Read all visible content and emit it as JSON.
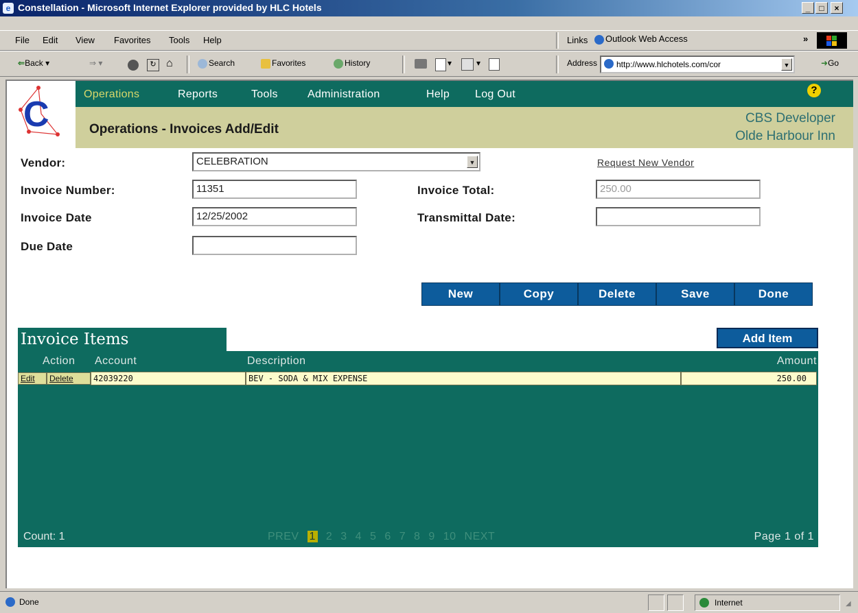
{
  "window": {
    "title": "Constellation - Microsoft Internet Explorer provided by HLC Hotels",
    "buttons": {
      "minimize": "_",
      "maximize": "□",
      "close": "×"
    }
  },
  "menu": {
    "items": [
      "File",
      "Edit",
      "View",
      "Favorites",
      "Tools",
      "Help"
    ],
    "links_label": "Links",
    "links_item": "Outlook Web Access",
    "chevron": "»"
  },
  "toolbar": {
    "back": "Back",
    "search": "Search",
    "favorites": "Favorites",
    "history": "History",
    "address_label": "Address",
    "address_value": "http://www.hlchotels.com/cor",
    "go": "Go"
  },
  "app": {
    "nav": [
      "Operations",
      "Reports",
      "Tools",
      "Administration",
      "Help",
      "Log Out"
    ],
    "help_icon": "?",
    "page_title": "Operations - Invoices Add/Edit",
    "user_name": "CBS Developer",
    "hotel_name": "Olde Harbour Inn"
  },
  "form": {
    "vendor_label": "Vendor:",
    "vendor_value": "CELEBRATION",
    "request_vendor": "Request New Vendor",
    "invoice_number_label": "Invoice Number:",
    "invoice_number_value": "11351",
    "invoice_total_label": "Invoice Total:",
    "invoice_total_value": "250.00",
    "invoice_date_label": "Invoice Date",
    "invoice_date_value": "12/25/2002",
    "transmittal_date_label": "Transmittal Date:",
    "transmittal_date_value": "",
    "due_date_label": "Due Date",
    "due_date_value": ""
  },
  "actions": {
    "new": "New",
    "copy": "Copy",
    "delete": "Delete",
    "save": "Save",
    "done": "Done"
  },
  "items": {
    "tab_title": "Invoice Items",
    "add_item": "Add Item",
    "columns": {
      "action": "Action",
      "account": "Account",
      "description": "Description",
      "amount": "Amount"
    },
    "rows": [
      {
        "edit": "Edit",
        "delete": "Delete",
        "account": "42039220",
        "description": "BEV - SODA & MIX EXPENSE",
        "amount": "250.00"
      }
    ],
    "count": "Count: 1",
    "pager": {
      "prev": "PREV",
      "pages": [
        "1",
        "2",
        "3",
        "4",
        "5",
        "6",
        "7",
        "8",
        "9",
        "10"
      ],
      "next": "NEXT",
      "current": "1"
    },
    "page_info": "Page 1 of 1"
  },
  "status": {
    "left": "Done",
    "zone": "Internet"
  }
}
